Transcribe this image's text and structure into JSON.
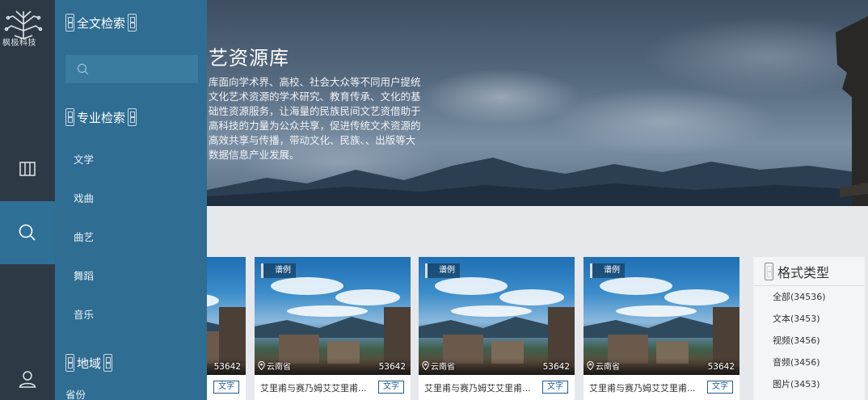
{
  "brand": {
    "logo_text": "枫极科技"
  },
  "hero": {
    "title": "艺资源库",
    "description": "库面向学术界、高校、社会大众等不同用户提统文化艺术资源的学术研究、教育传承、文化的基础性资源服务，让海量的民族民间文艺资借助于高科技的力量为公众共享，促进传统文术资源的高效共享与传播，带动文化、民族、、出版等大数据信息产业发展。"
  },
  "rail": {
    "items": [
      {
        "name": "library",
        "icon": "book-icon"
      },
      {
        "name": "search",
        "icon": "search-icon",
        "active": true
      },
      {
        "name": "user",
        "icon": "user-icon"
      }
    ]
  },
  "panel": {
    "fulltext_title": "全文检索",
    "search_placeholder": "",
    "professional_title": "专业检索",
    "categories": [
      "文学",
      "戏曲",
      "曲艺",
      "舞蹈",
      "音乐"
    ],
    "region_title": "地域",
    "province_label": "省份"
  },
  "cards": [
    {
      "tag": "",
      "location": "",
      "count": "53642",
      "title": "",
      "type": "文字"
    },
    {
      "tag": "谱例",
      "location": "云南省",
      "count": "53642",
      "title": "艾里甫与赛乃姆艾艾里甫...",
      "type": "文字"
    },
    {
      "tag": "谱例",
      "location": "云南省",
      "count": "53642",
      "title": "艾里甫与赛乃姆艾艾里甫...",
      "type": "文字"
    },
    {
      "tag": "谱例",
      "location": "云南省",
      "count": "53642",
      "title": "艾里甫与赛乃姆艾艾里甫...",
      "type": "文字"
    }
  ],
  "format": {
    "title": "格式类型",
    "items": [
      "全部(34536)",
      "文本(3453)",
      "视频(3456)",
      "音频(3456)",
      "图片(3453)"
    ]
  },
  "colors": {
    "rail": "#2d3a46",
    "panel": "#2f6d92",
    "active": "#2f7097",
    "accent": "#1f5b96"
  }
}
